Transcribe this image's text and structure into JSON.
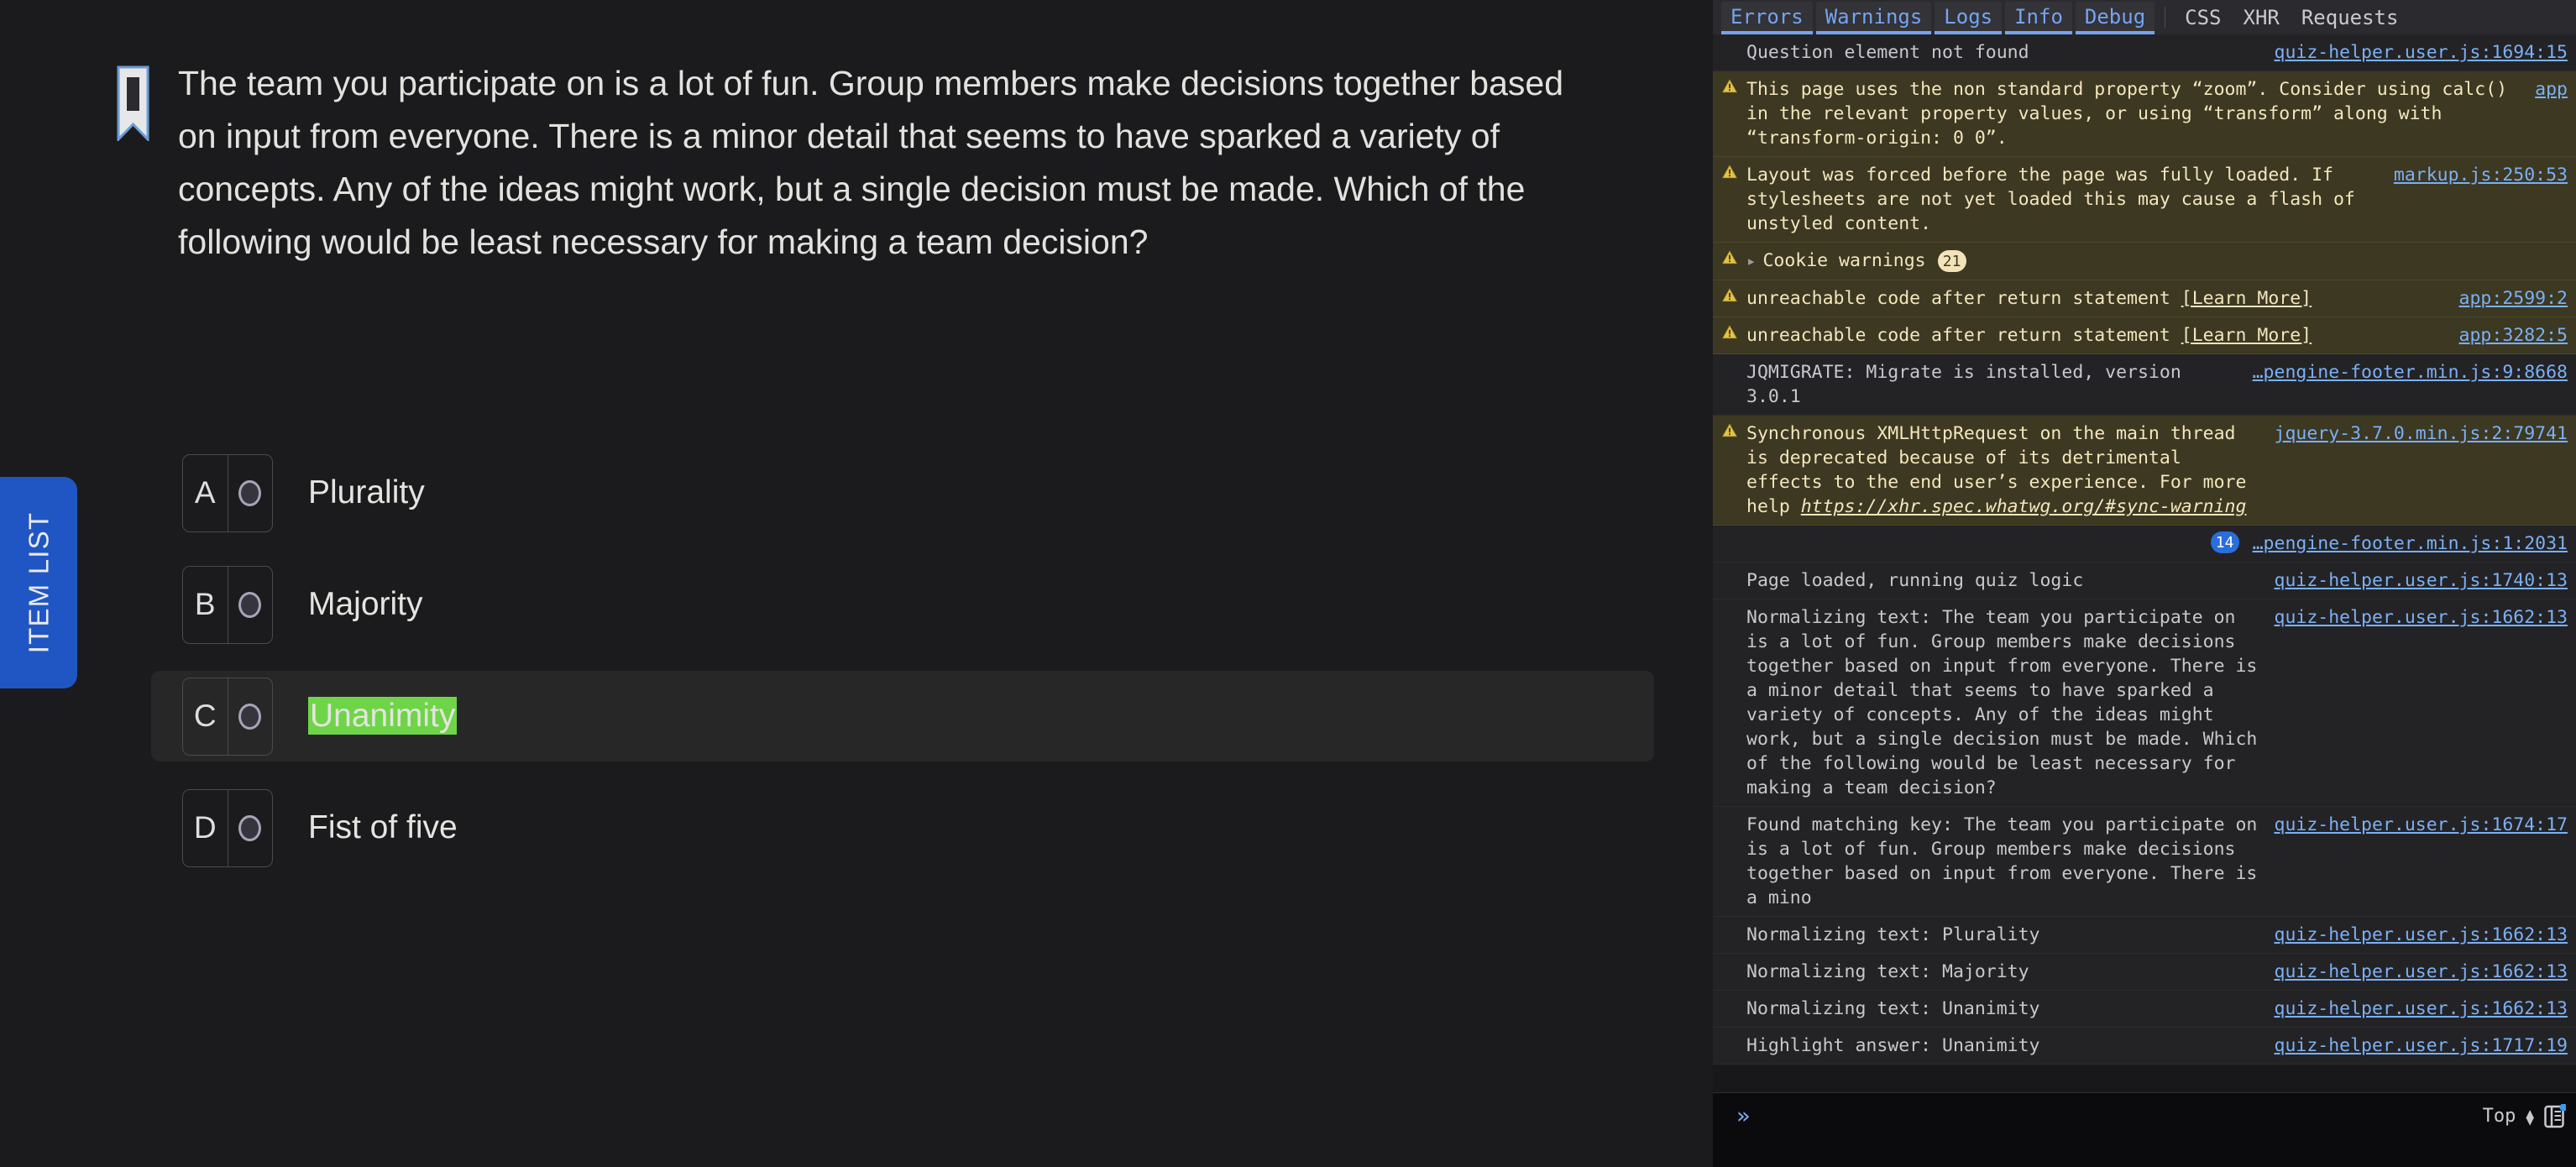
{
  "quiz": {
    "item_list_tab_label": "ITEM LIST",
    "bookmark_icon": "bookmark-flag-icon",
    "question": "The team you participate on is a lot of fun. Group members make decisions together based on input from everyone. There is a minor detail that seems to have sparked a variety of concepts. Any of the ideas might work, but a single decision must be made. Which of the following would be least necessary for making a team decision?",
    "highlight_color": "#6ed548",
    "options": [
      {
        "letter": "A",
        "label": "Plurality",
        "highlighted": false,
        "hovered": false,
        "selected": false
      },
      {
        "letter": "B",
        "label": "Majority",
        "highlighted": false,
        "hovered": false,
        "selected": false
      },
      {
        "letter": "C",
        "label": "Unanimity",
        "highlighted": true,
        "hovered": true,
        "selected": false
      },
      {
        "letter": "D",
        "label": "Fist of five",
        "highlighted": false,
        "hovered": false,
        "selected": false
      }
    ]
  },
  "console": {
    "toolbar": {
      "filters": [
        "Errors",
        "Warnings",
        "Logs",
        "Info",
        "Debug"
      ],
      "categories": [
        "CSS",
        "XHR",
        "Requests"
      ]
    },
    "rows": [
      {
        "kind": "error",
        "icon": "",
        "message": "Question element not found",
        "source": "quiz-helper.user.js:1694:15"
      },
      {
        "kind": "warn",
        "icon": "warning-triangle-icon",
        "message": "This page uses the non standard property “zoom”. Consider using calc() in the relevant property values, or using “transform” along with “transform-origin: 0 0”.",
        "source": "app"
      },
      {
        "kind": "warn",
        "icon": "warning-triangle-icon",
        "message": "Layout was forced before the page was fully loaded. If stylesheets are not yet loaded this may cause a flash of unstyled content.",
        "source": "markup.js:250:53"
      },
      {
        "kind": "warn",
        "icon": "warning-triangle-icon",
        "twisty": "▸",
        "message": "Cookie warnings",
        "badge": "21",
        "source": ""
      },
      {
        "kind": "warn",
        "icon": "warning-triangle-icon",
        "message": "unreachable code after return statement ",
        "learn_more": "[Learn More]",
        "source": "app:2599:2"
      },
      {
        "kind": "warn",
        "icon": "warning-triangle-icon",
        "message": "unreachable code after return statement ",
        "learn_more": "[Learn More]",
        "source": "app:3282:5"
      },
      {
        "kind": "log",
        "icon": "",
        "message": "JQMIGRATE: Migrate is installed, version 3.0.1",
        "source": "…pengine-footer.min.js:9:8668"
      },
      {
        "kind": "warn",
        "icon": "warning-triangle-icon",
        "message": "Synchronous XMLHttpRequest on the main thread is deprecated because of its detrimental effects to the end user’s experience. For more help ",
        "inline_link": "https://xhr.spec.whatwg.org/#sync-warning",
        "source": "jquery-3.7.0.min.js:2:79741"
      },
      {
        "kind": "log",
        "icon": "",
        "message": "",
        "blue_badge": "14",
        "source": "…pengine-footer.min.js:1:2031"
      },
      {
        "kind": "log",
        "icon": "",
        "message": "Page loaded, running quiz logic",
        "source": "quiz-helper.user.js:1740:13"
      },
      {
        "kind": "log",
        "icon": "",
        "message": "Normalizing text: The team you participate on is a lot of fun. Group members make decisions together based on input from everyone. There is a minor detail that seems to have sparked a variety of concepts. Any of the ideas might work, but a single decision must be made. Which of the following would be least necessary for making a team decision?",
        "source": "quiz-helper.user.js:1662:13"
      },
      {
        "kind": "log",
        "icon": "",
        "message": "Found matching key: The team you participate on is a lot of fun. Group members make decisions together based on input from everyone. There is a mino",
        "source": "quiz-helper.user.js:1674:17"
      },
      {
        "kind": "log",
        "icon": "",
        "message": "Normalizing text: Plurality",
        "source": "quiz-helper.user.js:1662:13"
      },
      {
        "kind": "log",
        "icon": "",
        "message": "Normalizing text: Majority",
        "source": "quiz-helper.user.js:1662:13"
      },
      {
        "kind": "log",
        "icon": "",
        "message": "Normalizing text: Unanimity",
        "source": "quiz-helper.user.js:1662:13"
      },
      {
        "kind": "log",
        "icon": "",
        "message": "Highlight answer: Unanimity",
        "source": "quiz-helper.user.js:1717:19"
      }
    ],
    "footer": {
      "chevrons": "»",
      "position_label": "Top",
      "split_console_icon": "split-console-icon"
    }
  }
}
